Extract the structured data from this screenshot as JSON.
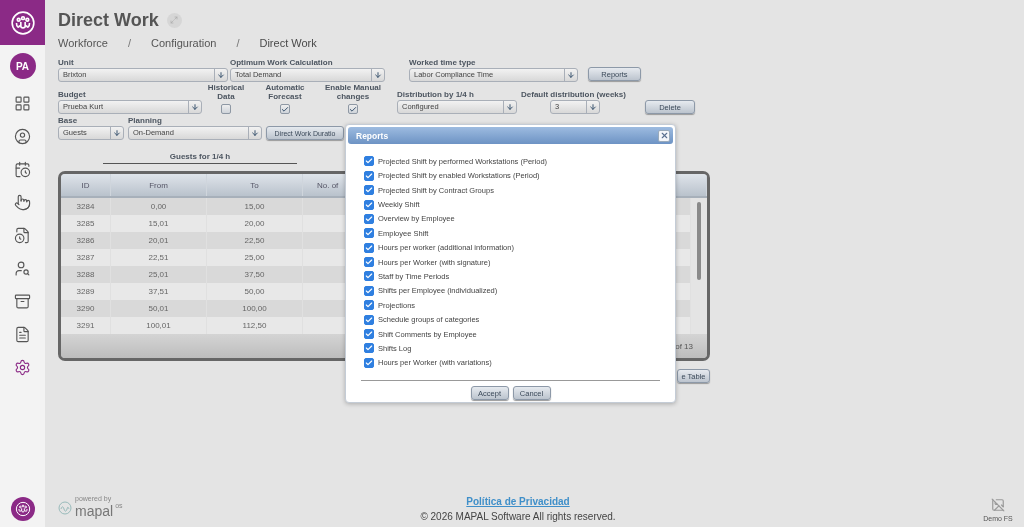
{
  "sidebar": {
    "avatar": "PA",
    "items": [
      {
        "selected": false
      },
      {
        "selected": false
      },
      {
        "selected": false
      },
      {
        "selected": false
      },
      {
        "selected": false
      },
      {
        "selected": false
      },
      {
        "selected": false
      },
      {
        "selected": false
      },
      {
        "selected": true
      }
    ]
  },
  "page": {
    "title": "Direct Work",
    "breadcrumb": [
      {
        "kind": "link",
        "text": "Workforce"
      },
      {
        "kind": "separator",
        "text": "/"
      },
      {
        "kind": "link",
        "text": "Configuration"
      },
      {
        "kind": "separator",
        "text": "/"
      },
      {
        "kind": "current",
        "text": "Direct Work"
      }
    ]
  },
  "form": {
    "unit": {
      "label": "Unit",
      "value": "Brixton"
    },
    "optimum": {
      "label": "Optimum Work Calculation",
      "value": "Total Demand"
    },
    "worked_time": {
      "label": "Worked time type",
      "value": "Labor Compliance Time"
    },
    "reports_button": "Reports",
    "budget": {
      "label": "Budget",
      "value": "Prueba Kurt"
    },
    "flags": [
      {
        "label": "Historical Data",
        "checked": false
      },
      {
        "label": "Automatic Forecast",
        "checked": true
      },
      {
        "label": "Enable Manual changes",
        "checked": true
      }
    ],
    "distribution": {
      "label": "Distribution by 1/4 h",
      "value": "Configured"
    },
    "default_distribution": {
      "label": "Default distribution (weeks)",
      "value": "3"
    },
    "delete_button": "Delete",
    "base": {
      "label": "Base",
      "value": "Guests"
    },
    "planning": {
      "label": "Planning",
      "value": "On-Demand"
    },
    "duration_button": "Direct Work Duratio"
  },
  "table": {
    "title": "Guests for 1/4 h",
    "columns": [
      "ID",
      "From",
      "To",
      "No. of"
    ],
    "rows": [
      [
        "3284",
        "0,00",
        "15,00"
      ],
      [
        "3285",
        "15,01",
        "20,00"
      ],
      [
        "3286",
        "20,01",
        "22,50"
      ],
      [
        "3287",
        "22,51",
        "25,00"
      ],
      [
        "3288",
        "25,01",
        "37,50"
      ],
      [
        "3289",
        "37,51",
        "50,00"
      ],
      [
        "3290",
        "50,01",
        "100,00"
      ],
      [
        "3291",
        "100,01",
        "112,50"
      ]
    ],
    "pager": "of 13",
    "button": "e Table"
  },
  "dialog": {
    "title": "Reports",
    "items": [
      {
        "label": "Projected Shift by performed Workstations (Period)",
        "checked": true
      },
      {
        "label": "Projected Shift by enabled Workstations (Period)",
        "checked": true
      },
      {
        "label": "Projected Shift by Contract Groups",
        "checked": true
      },
      {
        "label": "Weekly Shift",
        "checked": true
      },
      {
        "label": "Overview by Employee",
        "checked": true
      },
      {
        "label": "Employee Shift",
        "checked": true
      },
      {
        "label": "Hours per worker (additional information)",
        "checked": true
      },
      {
        "label": "Hours per Worker (with signature)",
        "checked": true
      },
      {
        "label": "Staff by Time Periods",
        "checked": true
      },
      {
        "label": "Shifts per Employee (individualized)",
        "checked": true
      },
      {
        "label": "Projections",
        "checked": true
      },
      {
        "label": "Schedule groups of categories",
        "checked": true
      },
      {
        "label": "Shift Comments by Employee",
        "checked": true
      },
      {
        "label": "Shifts Log",
        "checked": true
      },
      {
        "label": "Hours per Worker (with variations)",
        "checked": true
      }
    ],
    "buttons": [
      "Accept",
      "Cancel"
    ]
  },
  "footer": {
    "powered_by": "powered by",
    "brand": "mapal",
    "brand_suffix": "os",
    "privacy": "Política de Privacidad",
    "copyright": "© 2026 MAPAL Software All rights reserved.",
    "user": "Demo FS"
  }
}
